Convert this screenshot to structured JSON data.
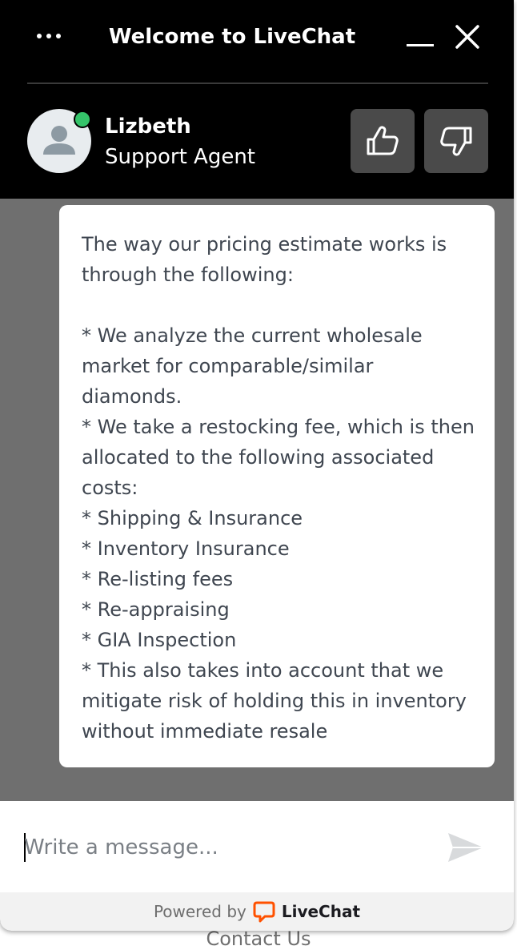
{
  "header": {
    "title": "Welcome to LiveChat",
    "menu_icon": "more-horizontal-icon",
    "minimize_icon": "minimize-icon",
    "close_icon": "close-icon"
  },
  "agent": {
    "name": "Lizbeth",
    "role": "Support Agent",
    "status": "online",
    "status_color": "#35c46a"
  },
  "rating": {
    "good_icon": "thumbs-up-icon",
    "bad_icon": "thumbs-down-icon"
  },
  "message": {
    "lines": [
      "The way our pricing estimate works is through the following:",
      "",
      "* We analyze the current wholesale market for comparable/similar diamonds.",
      "* We take a restocking fee, which is then allocated to the following associated costs:",
      "* Shipping & Insurance",
      "* Inventory Insurance",
      "* Re-listing fees",
      "* Re-appraising",
      "* GIA Inspection",
      "* This also takes into account that we mitigate risk of holding this in inventory without immediate resale"
    ]
  },
  "composer": {
    "placeholder": "Write a message...",
    "value": "",
    "send_icon": "send-icon"
  },
  "footer": {
    "powered_by": "Powered by",
    "brand": "LiveChat",
    "brand_color": "#ff5100"
  },
  "background": {
    "partial_text": "Contact Us"
  },
  "colors": {
    "header_bg": "#000000",
    "overlay_bg": "#6f6f6f",
    "button_bg": "#4a4a4a"
  }
}
